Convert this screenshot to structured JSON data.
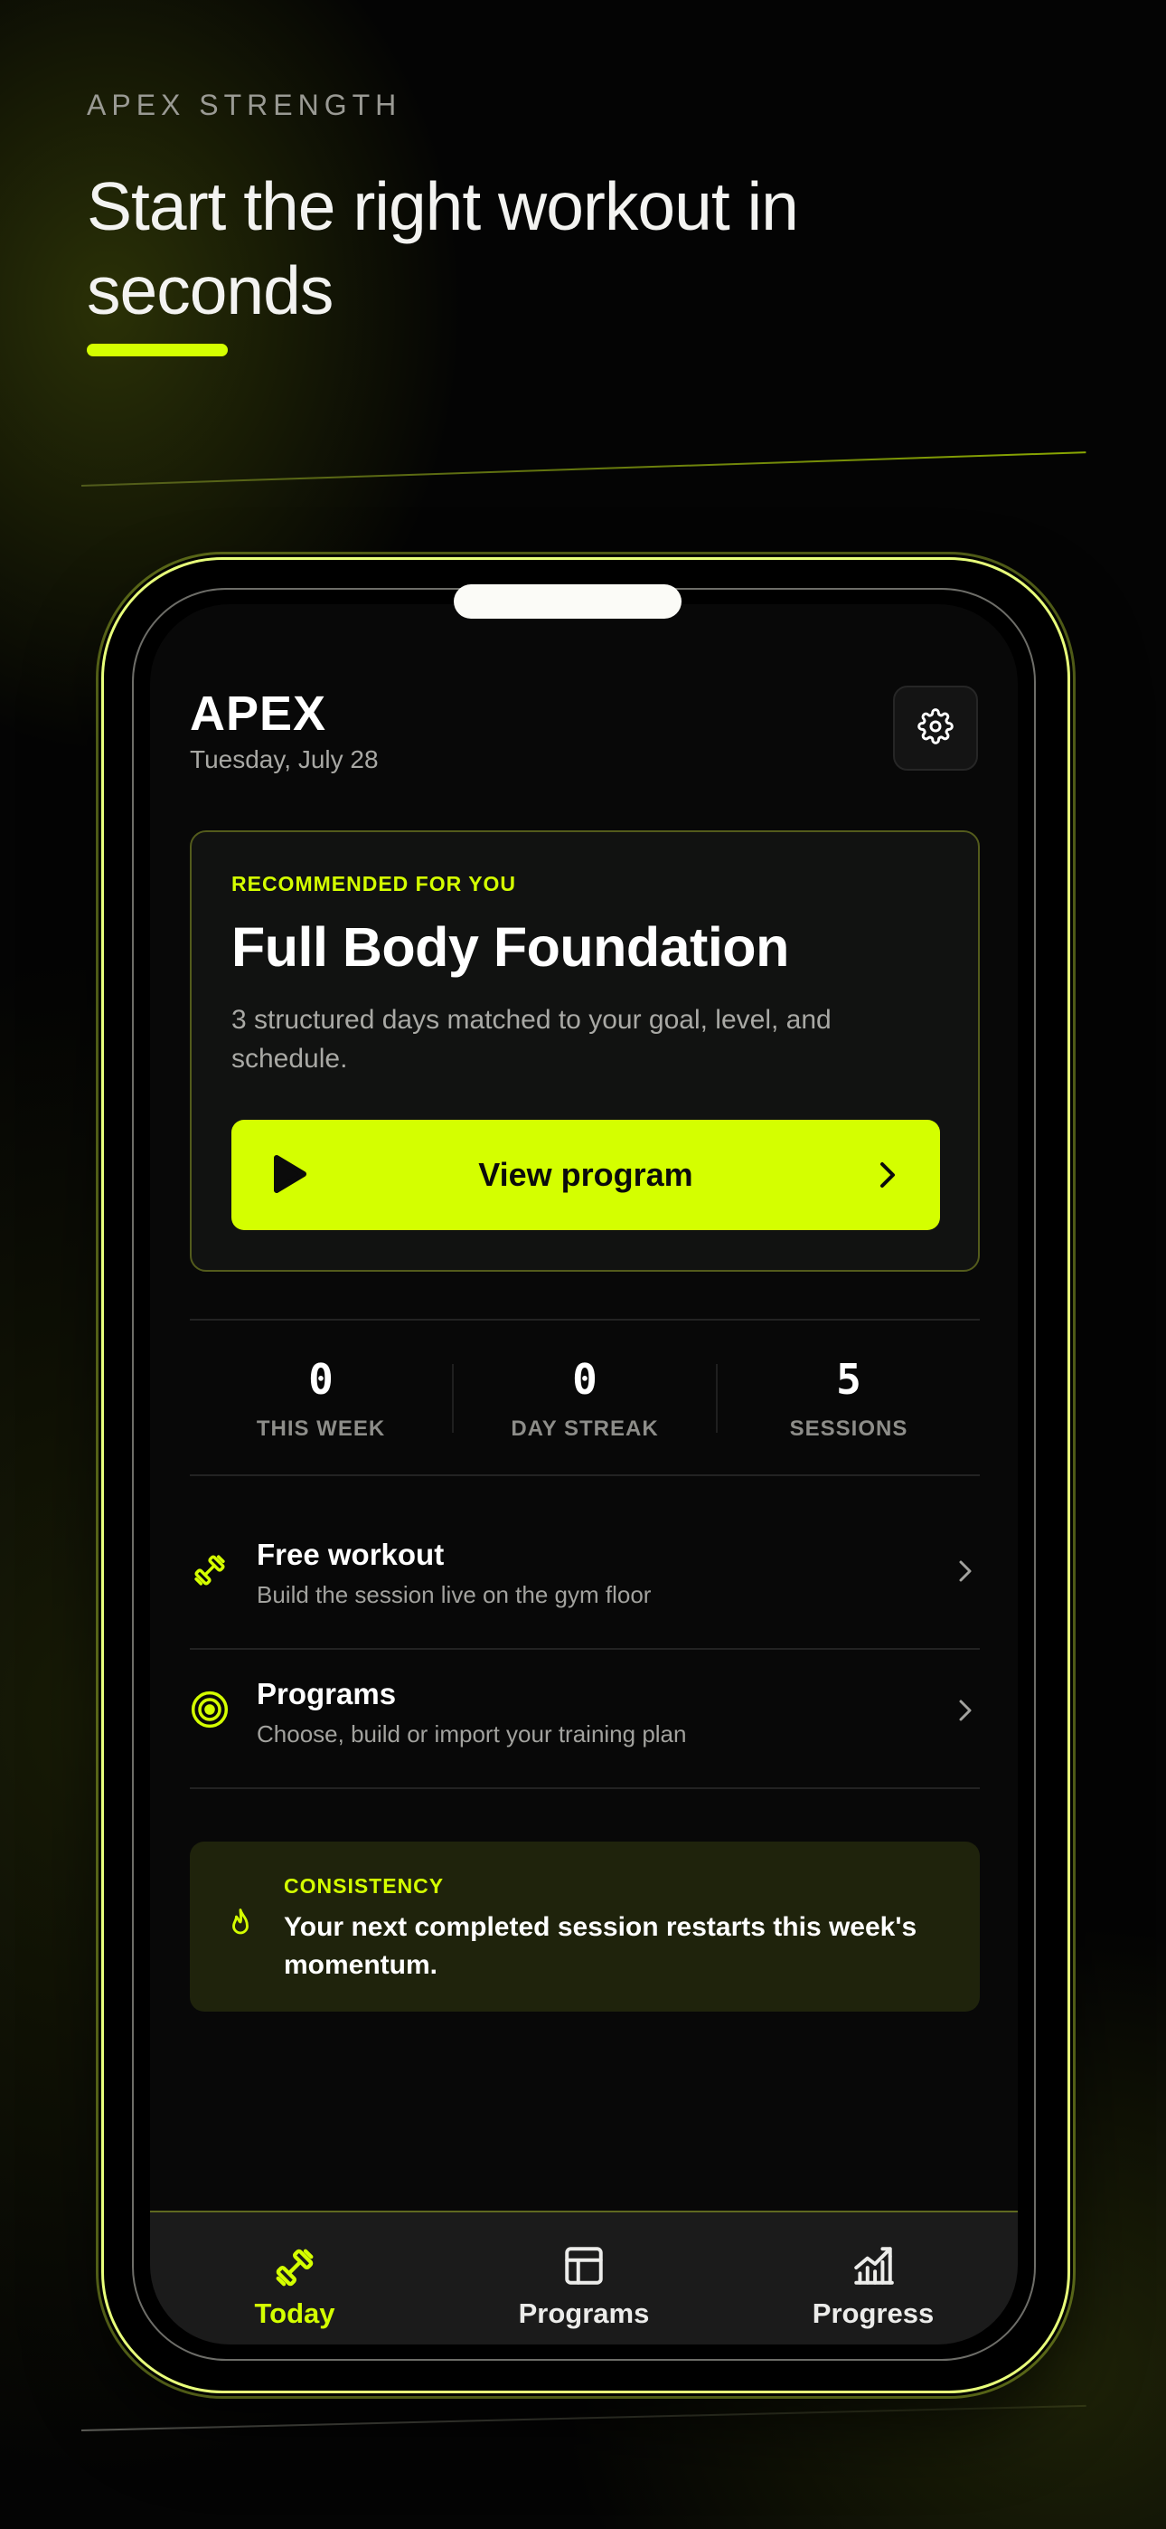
{
  "promo": {
    "eyebrow": "APEX STRENGTH",
    "headline": "Start the right workout in seconds"
  },
  "header": {
    "title": "APEX",
    "date": "Tuesday, July 28",
    "settings_icon": "gear-icon"
  },
  "recommendation": {
    "label": "RECOMMENDED FOR YOU",
    "title": "Full Body Foundation",
    "description": "3 structured days matched to your goal, level, and schedule.",
    "button_label": "View program"
  },
  "stats": [
    {
      "value": "0",
      "label": "THIS WEEK"
    },
    {
      "value": "0",
      "label": "DAY STREAK"
    },
    {
      "value": "5",
      "label": "SESSIONS"
    }
  ],
  "actions": [
    {
      "title": "Free workout",
      "subtitle": "Build the session live on the gym floor",
      "icon": "dumbbell-icon"
    },
    {
      "title": "Programs",
      "subtitle": "Choose, build or import your training plan",
      "icon": "target-icon"
    }
  ],
  "consistency": {
    "label": "CONSISTENCY",
    "message": "Your next completed session restarts this week's momentum.",
    "icon": "flame-icon"
  },
  "tabs": [
    {
      "label": "Today",
      "icon": "dumbbell-icon",
      "active": true
    },
    {
      "label": "Programs",
      "icon": "layout-icon",
      "active": false
    },
    {
      "label": "Progress",
      "icon": "chart-icon",
      "active": false
    }
  ],
  "colors": {
    "accent": "#d4ff00",
    "background": "#040404",
    "card": "#111211",
    "consistency_card": "#1f230c"
  }
}
